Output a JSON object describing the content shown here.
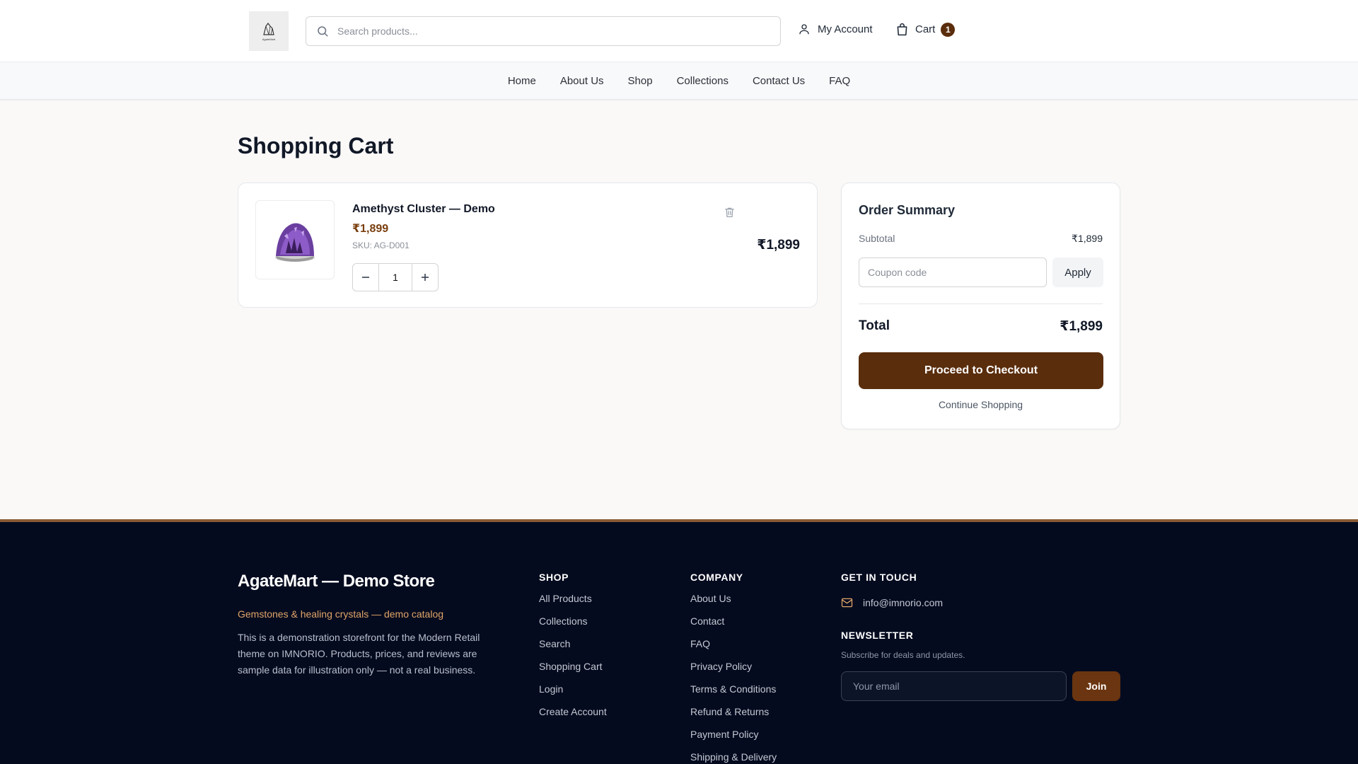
{
  "header": {
    "logo_text": "AgateMart",
    "search_placeholder": "Search products...",
    "account_label": "My Account",
    "cart_label": "Cart",
    "cart_count": "1"
  },
  "nav": {
    "items": [
      "Home",
      "About Us",
      "Shop",
      "Collections",
      "Contact Us",
      "FAQ"
    ]
  },
  "page": {
    "title": "Shopping Cart"
  },
  "cart": {
    "items": [
      {
        "name": "Amethyst Cluster — Demo",
        "price": "₹1,899",
        "sku": "SKU: AG-D001",
        "quantity": "1",
        "line_total": "₹1,899",
        "image_icon": "amethyst-cluster-image"
      }
    ]
  },
  "summary": {
    "title": "Order Summary",
    "subtotal_label": "Subtotal",
    "subtotal_value": "₹1,899",
    "coupon_placeholder": "Coupon code",
    "apply_label": "Apply",
    "total_label": "Total",
    "total_value": "₹1,899",
    "checkout_label": "Proceed to Checkout",
    "continue_label": "Continue Shopping"
  },
  "footer": {
    "brand": "AgateMart — Demo Store",
    "tagline": "Gemstones & healing crystals — demo catalog",
    "description": "This is a demonstration storefront for the Modern Retail theme on IMNORIO. Products, prices, and reviews are sample data for illustration only — not a real business.",
    "shop": {
      "heading": "SHOP",
      "links": [
        "All Products",
        "Collections",
        "Search",
        "Shopping Cart",
        "Login",
        "Create Account"
      ]
    },
    "company": {
      "heading": "COMPANY",
      "links": [
        "About Us",
        "Contact",
        "FAQ",
        "Privacy Policy",
        "Terms & Conditions",
        "Refund & Returns",
        "Payment Policy",
        "Shipping & Delivery"
      ]
    },
    "contact": {
      "heading": "GET IN TOUCH",
      "email": "info@imnorio.com"
    },
    "newsletter": {
      "heading": "NEWSLETTER",
      "subtitle": "Subscribe for deals and updates.",
      "placeholder": "Your email",
      "button": "Join"
    }
  },
  "colors": {
    "brand_brown": "#5a2d0c",
    "price_brown": "#7a3e0e",
    "footer_bg": "#050b1f",
    "footer_accent": "#e0a468"
  }
}
